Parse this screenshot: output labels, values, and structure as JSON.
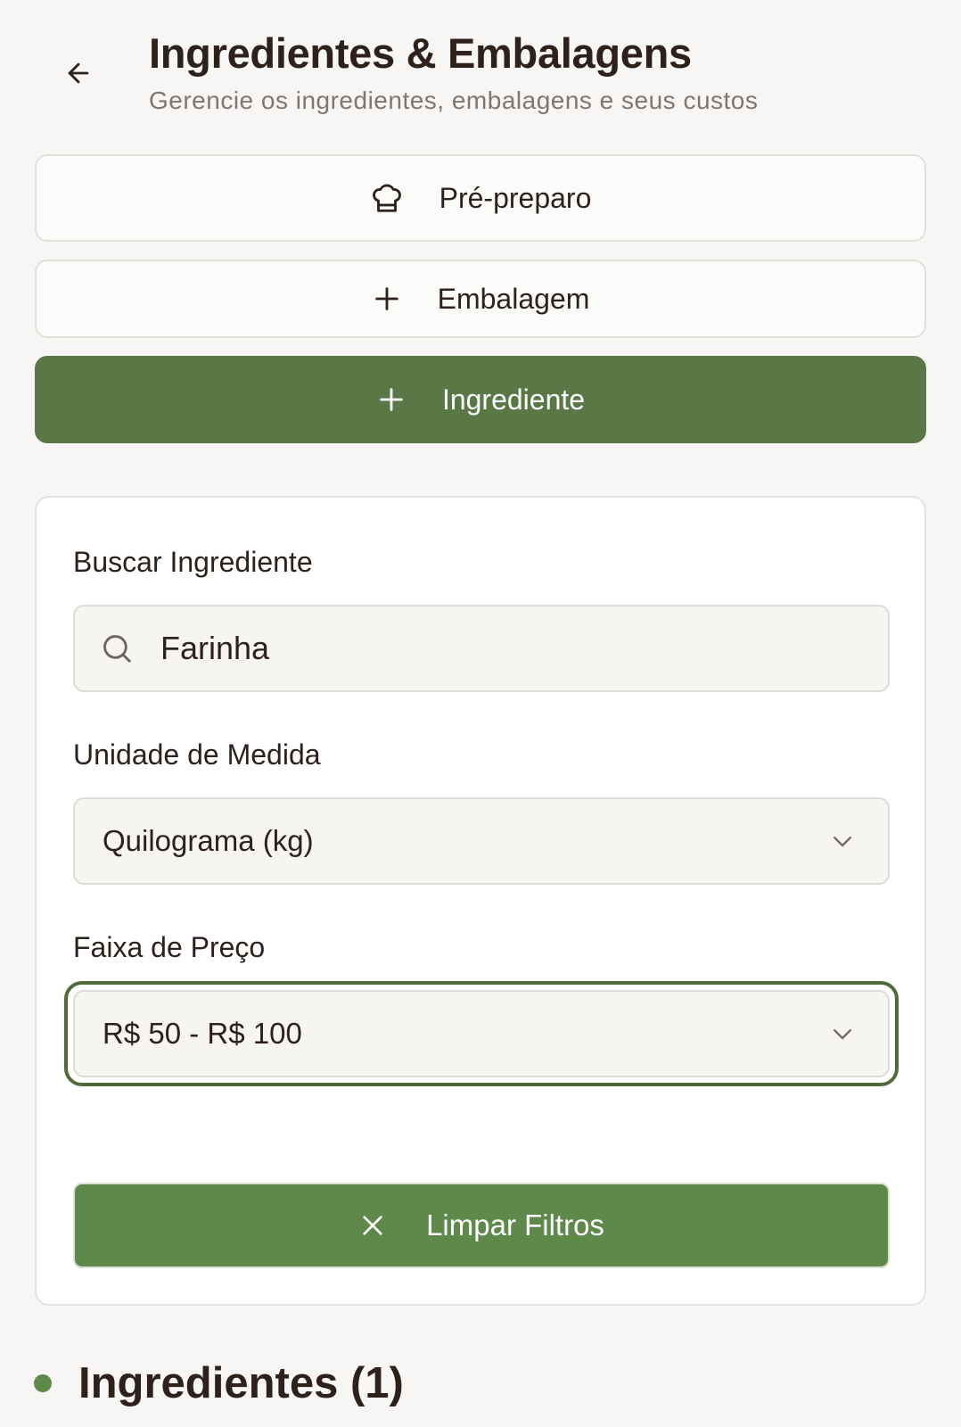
{
  "header": {
    "title": "Ingredientes & Embalagens",
    "subtitle": "Gerencie os ingredientes, embalagens e seus custos"
  },
  "actions": {
    "preparo_label": "Pré-preparo",
    "embalagem_label": "Embalagem",
    "ingrediente_label": "Ingrediente"
  },
  "filters": {
    "search_label": "Buscar Ingrediente",
    "search_value": "Farinha",
    "unit_label": "Unidade de Medida",
    "unit_value": "Quilograma (kg)",
    "price_label": "Faixa de Preço",
    "price_value": "R$ 50 - R$ 100",
    "clear_label": "Limpar Filtros"
  },
  "list": {
    "heading": "Ingredientes (1)"
  },
  "colors": {
    "primary": "#5a7846",
    "clear_button": "#5f884b",
    "text": "#2e211c"
  },
  "icons": [
    "arrow-left-icon",
    "chef-hat-icon",
    "plus-icon",
    "search-icon",
    "chevron-down-icon",
    "close-icon"
  ]
}
